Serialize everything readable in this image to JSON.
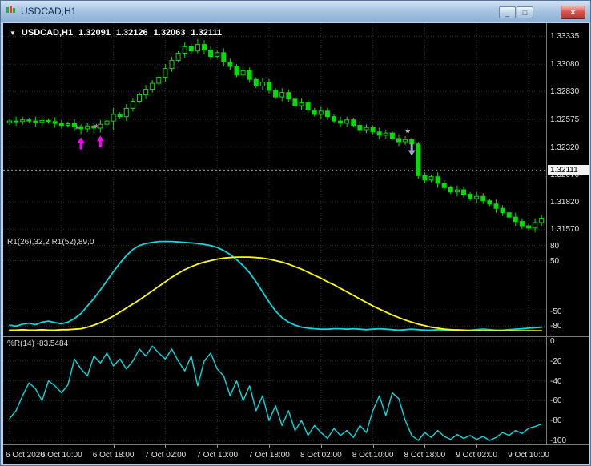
{
  "window": {
    "title": "USDCAD,H1",
    "minimize_glyph": "_",
    "maximize_glyph": "□",
    "close_glyph": "×"
  },
  "quote": {
    "dropdown_glyph": "▼",
    "symbol": "USDCAD,H1",
    "open": "1.32091",
    "high": "1.32126",
    "low": "1.32063",
    "close": "1.32111"
  },
  "colors": {
    "bg": "#000000",
    "candle": "#00E000",
    "bull_fill": "#000000",
    "grid": "#2E2E2E",
    "axis_text": "#E0E0E0",
    "cyan": "#00DDE0",
    "yellow": "#FFFF00",
    "buy_signal": "#FF00FF",
    "buy_star": "#EE82EE",
    "sell_signal": "#A9A5D9",
    "sell_star": "#E8E6F8",
    "bid_line": "#9CA0A8"
  },
  "price_axis": {
    "labels": [
      "1.33335",
      "1.33080",
      "1.32830",
      "1.32575",
      "1.32320",
      "1.32070",
      "1.31820",
      "1.31570"
    ],
    "max": 1.33455,
    "min": 1.3152,
    "current": "1.32111",
    "current_value": 1.32111
  },
  "time_axis": {
    "labels": [
      "6 Oct 2020",
      "6 Oct 10:00",
      "6 Oct 18:00",
      "7 Oct 02:00",
      "7 Oct 10:00",
      "7 Oct 18:00",
      "8 Oct 02:00",
      "8 Oct 10:00",
      "8 Oct 18:00",
      "9 Oct 02:00",
      "9 Oct 10:00"
    ],
    "indices": [
      0,
      8,
      16,
      24,
      32,
      40,
      48,
      56,
      64,
      72,
      80
    ]
  },
  "chart_data": [
    {
      "type": "candlestick",
      "title": "USDCAD H1 price",
      "ohlc": [
        [
          1.32545,
          1.3258,
          1.32525,
          1.3256
        ],
        [
          1.3256,
          1.326,
          1.32515,
          1.32555
        ],
        [
          1.32555,
          1.326,
          1.32525,
          1.3257
        ],
        [
          1.3257,
          1.3259,
          1.3254,
          1.3256
        ],
        [
          1.3256,
          1.326,
          1.32508,
          1.32548
        ],
        [
          1.32548,
          1.32595,
          1.32518,
          1.32565
        ],
        [
          1.32565,
          1.32585,
          1.32535,
          1.32555
        ],
        [
          1.32555,
          1.32595,
          1.32498,
          1.32538
        ],
        [
          1.32538,
          1.32568,
          1.3249,
          1.3252
        ],
        [
          1.3252,
          1.32555,
          1.325,
          1.32535
        ],
        [
          1.32535,
          1.32575,
          1.32468,
          1.32508
        ],
        [
          1.32508,
          1.3253,
          1.3244,
          1.32488
        ],
        [
          1.32488,
          1.32545,
          1.32458,
          1.32515
        ],
        [
          1.32515,
          1.3254,
          1.32445,
          1.32495
        ],
        [
          1.32495,
          1.3257,
          1.32455,
          1.3253
        ],
        [
          1.3253,
          1.3259,
          1.325,
          1.3256
        ],
        [
          1.3256,
          1.3268,
          1.3248,
          1.3262
        ],
        [
          1.3262,
          1.3264,
          1.3258,
          1.326
        ],
        [
          1.326,
          1.32715,
          1.3256,
          1.32675
        ],
        [
          1.32675,
          1.3277,
          1.32645,
          1.3274
        ],
        [
          1.3274,
          1.3282,
          1.3272,
          1.328
        ],
        [
          1.328,
          1.3289,
          1.3276,
          1.3285
        ],
        [
          1.3285,
          1.32935,
          1.3282,
          1.32905
        ],
        [
          1.32905,
          1.3298,
          1.32885,
          1.3296
        ],
        [
          1.3296,
          1.3308,
          1.3292,
          1.3304
        ],
        [
          1.3304,
          1.33145,
          1.3301,
          1.33115
        ],
        [
          1.33115,
          1.332,
          1.33095,
          1.3318
        ],
        [
          1.3318,
          1.3328,
          1.3314,
          1.3324
        ],
        [
          1.3324,
          1.3327,
          1.3317,
          1.332
        ],
        [
          1.332,
          1.3331,
          1.3318,
          1.3326
        ],
        [
          1.3326,
          1.333,
          1.3317,
          1.3321
        ],
        [
          1.3321,
          1.3324,
          1.3312,
          1.3315
        ],
        [
          1.3315,
          1.33205,
          1.3313,
          1.33185
        ],
        [
          1.33185,
          1.33225,
          1.3306,
          1.331
        ],
        [
          1.331,
          1.3313,
          1.3303,
          1.3306
        ],
        [
          1.3306,
          1.3308,
          1.3296,
          1.3298
        ],
        [
          1.3298,
          1.3306,
          1.3294,
          1.3302
        ],
        [
          1.3302,
          1.3305,
          1.3291,
          1.3294
        ],
        [
          1.3294,
          1.3296,
          1.3286,
          1.3288
        ],
        [
          1.3288,
          1.32955,
          1.3284,
          1.32915
        ],
        [
          1.32915,
          1.32945,
          1.3281,
          1.3284
        ],
        [
          1.3284,
          1.3286,
          1.3276,
          1.3278
        ],
        [
          1.3278,
          1.3286,
          1.3274,
          1.3282
        ],
        [
          1.3282,
          1.3285,
          1.3273,
          1.3276
        ],
        [
          1.3276,
          1.3278,
          1.3268,
          1.327
        ],
        [
          1.327,
          1.32765,
          1.3266,
          1.32725
        ],
        [
          1.32725,
          1.32755,
          1.3263,
          1.3266
        ],
        [
          1.3266,
          1.3268,
          1.326,
          1.3262
        ],
        [
          1.3262,
          1.3269,
          1.3258,
          1.3265
        ],
        [
          1.3265,
          1.3268,
          1.3257,
          1.326
        ],
        [
          1.326,
          1.3262,
          1.3254,
          1.3256
        ],
        [
          1.3256,
          1.326,
          1.325,
          1.3254
        ],
        [
          1.3254,
          1.326,
          1.3251,
          1.3257
        ],
        [
          1.3257,
          1.3259,
          1.325,
          1.3252
        ],
        [
          1.3252,
          1.3256,
          1.3244,
          1.3248
        ],
        [
          1.3248,
          1.3253,
          1.3245,
          1.325
        ],
        [
          1.325,
          1.3252,
          1.3244,
          1.3246
        ],
        [
          1.3246,
          1.325,
          1.3239,
          1.3243
        ],
        [
          1.3243,
          1.3248,
          1.324,
          1.3245
        ],
        [
          1.3245,
          1.3247,
          1.3238,
          1.324
        ],
        [
          1.324,
          1.3244,
          1.3233,
          1.3237
        ],
        [
          1.3237,
          1.3242,
          1.3234,
          1.3239
        ],
        [
          1.3239,
          1.3241,
          1.3233,
          1.3235
        ],
        [
          1.3235,
          1.3237,
          1.3203,
          1.3206
        ],
        [
          1.3206,
          1.3209,
          1.3199,
          1.3202
        ],
        [
          1.3202,
          1.3207,
          1.32,
          1.3205
        ],
        [
          1.3205,
          1.3209,
          1.3195,
          1.3199
        ],
        [
          1.3199,
          1.3202,
          1.3192,
          1.3195
        ],
        [
          1.3195,
          1.3197,
          1.3189,
          1.3191
        ],
        [
          1.3191,
          1.3197,
          1.3187,
          1.3193
        ],
        [
          1.3193,
          1.3196,
          1.3186,
          1.3189
        ],
        [
          1.3189,
          1.3191,
          1.3183,
          1.3185
        ],
        [
          1.3185,
          1.3191,
          1.3181,
          1.3187
        ],
        [
          1.3187,
          1.319,
          1.318,
          1.3183
        ],
        [
          1.3183,
          1.3185,
          1.3178,
          1.318
        ],
        [
          1.318,
          1.3184,
          1.3172,
          1.3176
        ],
        [
          1.3176,
          1.3179,
          1.3169,
          1.3172
        ],
        [
          1.3172,
          1.3174,
          1.3166,
          1.3168
        ],
        [
          1.3168,
          1.3172,
          1.316,
          1.3164
        ],
        [
          1.3164,
          1.3167,
          1.3157,
          1.316
        ],
        [
          1.316,
          1.3162,
          1.3156,
          1.3158
        ],
        [
          1.3158,
          1.3167,
          1.3154,
          1.3163
        ],
        [
          1.3163,
          1.317,
          1.316,
          1.3167
        ]
      ],
      "signals": [
        {
          "type": "buy",
          "index": 11
        },
        {
          "type": "buy",
          "index": 14
        },
        {
          "type": "sell",
          "index": 62
        }
      ]
    },
    {
      "type": "line",
      "label": "R1(26),32,2 R1(52),89,0",
      "range": [
        -100,
        100
      ],
      "axis_labels": [
        80,
        50,
        -50,
        -80
      ],
      "series": [
        {
          "name": "R1(26)",
          "color": "#00DDE0",
          "values": [
            -78,
            -80,
            -76,
            -74,
            -77,
            -72,
            -70,
            -73,
            -75,
            -72,
            -65,
            -55,
            -40,
            -25,
            -8,
            10,
            28,
            45,
            60,
            72,
            80,
            84,
            86,
            88,
            88,
            88,
            87,
            86,
            85,
            84,
            82,
            80,
            76,
            70,
            62,
            52,
            40,
            26,
            8,
            -12,
            -32,
            -50,
            -63,
            -72,
            -78,
            -82,
            -84,
            -85,
            -86,
            -86,
            -85,
            -85,
            -86,
            -85,
            -86,
            -87,
            -86,
            -85,
            -86,
            -87,
            -88,
            -87,
            -86,
            -87,
            -88,
            -88,
            -87,
            -88,
            -88,
            -87,
            -88,
            -88,
            -87,
            -86,
            -87,
            -88,
            -88,
            -87,
            -86,
            -85,
            -84,
            -83,
            -82
          ]
        },
        {
          "name": "R1(52)",
          "color": "#FFFF00",
          "values": [
            -88,
            -88,
            -87,
            -88,
            -88,
            -87,
            -88,
            -88,
            -87,
            -87,
            -86,
            -85,
            -82,
            -78,
            -73,
            -67,
            -60,
            -52,
            -44,
            -36,
            -28,
            -19,
            -10,
            -1,
            8,
            17,
            25,
            32,
            38,
            43,
            47,
            50,
            53,
            55,
            56,
            57,
            57,
            57,
            56,
            55,
            53,
            50,
            47,
            43,
            38,
            33,
            27,
            21,
            15,
            8,
            2,
            -5,
            -12,
            -19,
            -26,
            -33,
            -40,
            -46,
            -52,
            -58,
            -63,
            -68,
            -72,
            -76,
            -79,
            -82,
            -84,
            -86,
            -87,
            -88,
            -88,
            -89,
            -89,
            -89,
            -89,
            -89,
            -89,
            -89,
            -89,
            -89,
            -89,
            -89,
            -89
          ]
        }
      ]
    },
    {
      "type": "line",
      "label": "%R(14) -83.5484",
      "range": [
        0,
        -100
      ],
      "axis_labels": [
        0,
        -20,
        -40,
        -60,
        -80,
        -100
      ],
      "series": [
        {
          "name": "%R(14)",
          "color": "#00DDE0",
          "values": [
            -78,
            -70,
            -55,
            -42,
            -48,
            -60,
            -40,
            -45,
            -52,
            -44,
            -18,
            -28,
            -35,
            -15,
            -22,
            -12,
            -25,
            -18,
            -28,
            -20,
            -8,
            -15,
            -5,
            -12,
            -18,
            -8,
            -20,
            -30,
            -15,
            -45,
            -20,
            -12,
            -28,
            -35,
            -55,
            -40,
            -60,
            -45,
            -70,
            -55,
            -80,
            -65,
            -85,
            -70,
            -90,
            -80,
            -95,
            -85,
            -92,
            -98,
            -88,
            -95,
            -90,
            -97,
            -85,
            -92,
            -70,
            -55,
            -75,
            -52,
            -58,
            -80,
            -95,
            -100,
            -92,
            -97,
            -90,
            -96,
            -99,
            -94,
            -98,
            -95,
            -99,
            -96,
            -100,
            -97,
            -92,
            -95,
            -90,
            -93,
            -88,
            -86,
            -83.5484
          ]
        }
      ]
    }
  ]
}
